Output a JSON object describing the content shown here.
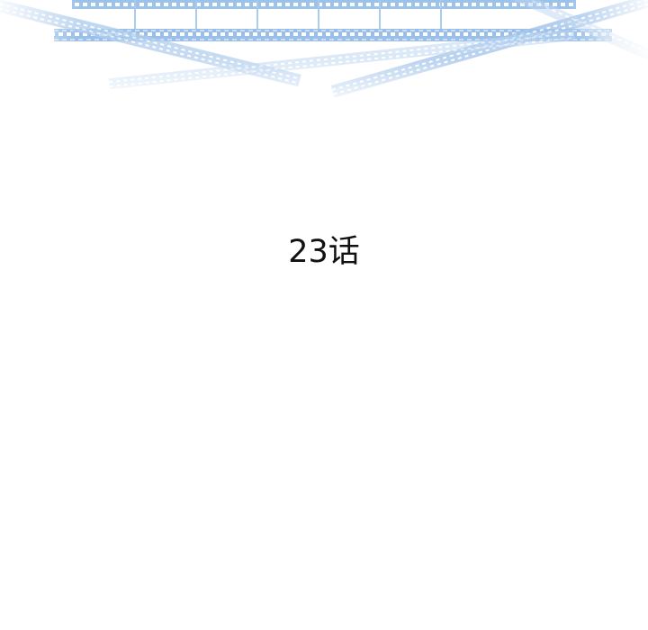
{
  "episode": {
    "title": "23话"
  },
  "banner": {
    "icon": "film-strip-icon",
    "colors": {
      "strip": "#8fb8e6",
      "strip_light": "#cfe0f4",
      "hole": "#ffffff",
      "background": "#ffffff"
    }
  }
}
